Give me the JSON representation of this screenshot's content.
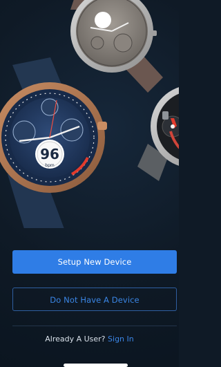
{
  "hero": {
    "watch_badge_number": "96",
    "watch_badge_unit": "bpm"
  },
  "actions": {
    "setup_label": "Setup New Device",
    "no_device_label": "Do Not Have A Device"
  },
  "signin": {
    "prompt": "Already A User?",
    "link_label": "Sign In"
  },
  "colors": {
    "background": "#0f1a26",
    "primary": "#2f7de6",
    "link": "#3b86e6"
  }
}
